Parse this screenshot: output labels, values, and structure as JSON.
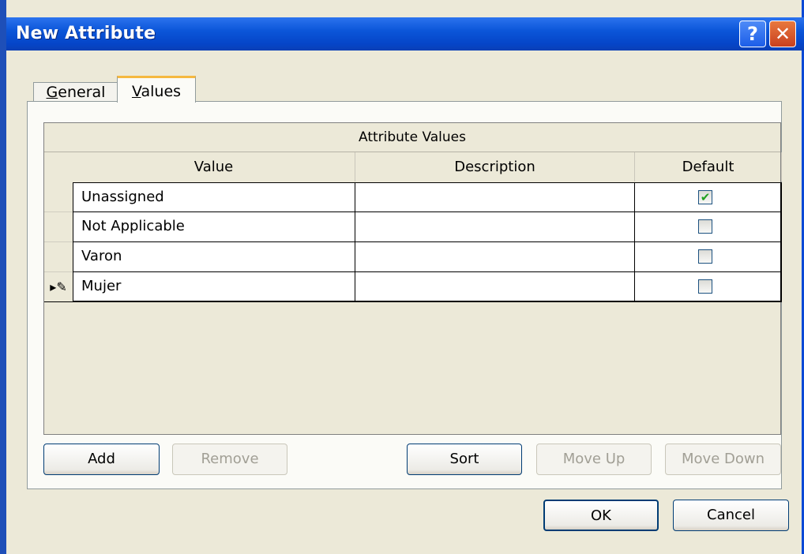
{
  "window": {
    "title": "New Attribute",
    "help_glyph": "?",
    "close_glyph": "✕"
  },
  "tabs": [
    {
      "pre": "",
      "key": "G",
      "post": "eneral"
    },
    {
      "pre": "",
      "key": "V",
      "post": "alues"
    }
  ],
  "grid": {
    "caption": "Attribute Values",
    "columns": [
      "Value",
      "Description",
      "Default"
    ],
    "rows": [
      {
        "value": "Unassigned",
        "description": "",
        "default": true
      },
      {
        "value": "Not Applicable",
        "description": "",
        "default": false
      },
      {
        "value": "Varon",
        "description": "",
        "default": false
      },
      {
        "value": "Mujer",
        "description": "",
        "default": false,
        "editing_glyph": "▸✎"
      }
    ]
  },
  "buttons": {
    "add": "Add",
    "remove": "Remove",
    "sort": "Sort",
    "move_up": "Move Up",
    "move_down": "Move Down",
    "ok": "OK",
    "cancel": "Cancel"
  },
  "colors": {
    "title_bar": "#0b56d9",
    "dialog_bg": "#ece9d8",
    "check": "#21a121"
  }
}
